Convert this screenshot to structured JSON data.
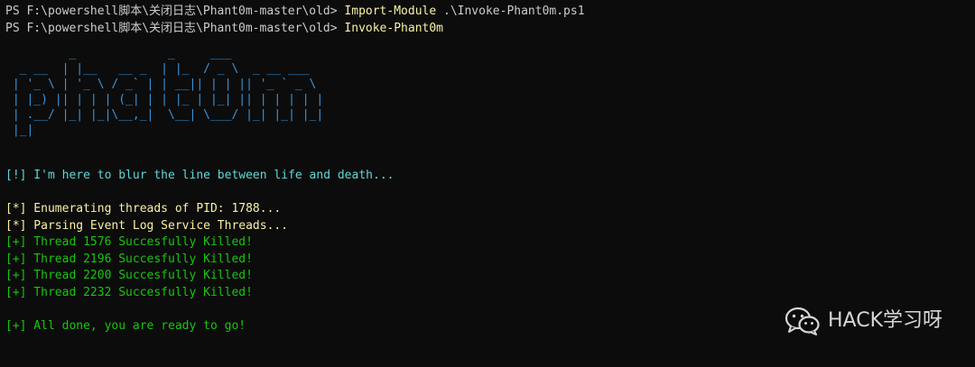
{
  "terminal": {
    "prompt": "PS F:\\powershell脚本\\关闭日志\\Phant0m-master\\old>",
    "commands": [
      {
        "cmd": "Import-Module",
        "arg": " .\\Invoke-Phant0m.ps1"
      },
      {
        "cmd": "Invoke-Phant0m",
        "arg": ""
      }
    ],
    "banner": "         _             _     ___\n  _ __  | |__   __ _  | |_  / _ \\  _ __ ___\n | '_ \\ | '_ \\ / _` | | __|| | | || '_ ` _ \\\n | |_) || | | | (_| | | |_ | |_| || | | | | |\n | .__/ |_| |_|\\__,_|  \\__| \\___/ |_| |_| |_|\n |_|",
    "intro": "[!] I'm here to blur the line between life and death...",
    "info": [
      "[*] Enumerating threads of PID: 1788...",
      "[*] Parsing Event Log Service Threads..."
    ],
    "results": [
      "[+] Thread 1576 Succesfully Killed!",
      "[+] Thread 2196 Succesfully Killed!",
      "[+] Thread 2200 Succesfully Killed!",
      "[+] Thread 2232 Succesfully Killed!"
    ],
    "done": "[+] All done, you are ready to go!"
  },
  "watermark": {
    "text": "HACK学习呀",
    "icon": "wechat-icon"
  },
  "colors": {
    "background": "#0c0c0c",
    "command": "#f9f1a5",
    "banner": "#3a96dd",
    "intro": "#61d6d6",
    "info": "#f9f1a5",
    "success": "#16c60c"
  }
}
